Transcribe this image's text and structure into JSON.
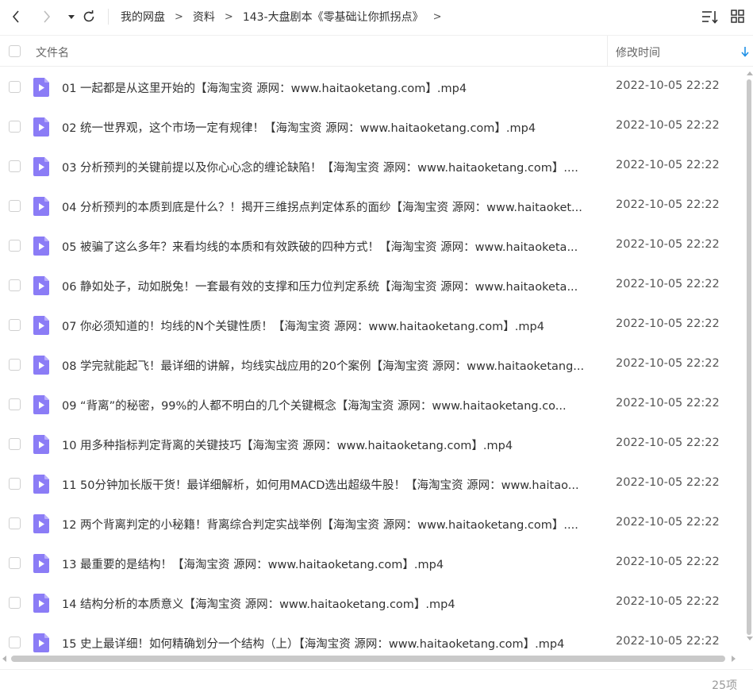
{
  "nav": {
    "back_icon": "chevron-left-icon",
    "forward_icon": "chevron-right-icon",
    "dropdown_icon": "caret-down-icon",
    "refresh_icon": "refresh-icon"
  },
  "breadcrumb": {
    "items": [
      "我的网盘",
      "资料",
      "143-大盘剧本《零基础让你抓拐点》"
    ],
    "separator": ">"
  },
  "toolbar": {
    "sort_icon": "sort-list-icon",
    "view_icon": "grid-view-icon"
  },
  "columns": {
    "name": "文件名",
    "time": "修改时间",
    "sort_icon": "sort-down-arrow-icon"
  },
  "colors": {
    "accent": "#1e90e6",
    "file_icon": "#8b7cf6"
  },
  "files": [
    {
      "name": "01 一起都是从这里开始的【海淘宝资 源网：www.haitaoketang.com】.mp4",
      "time": "2022-10-05 22:22"
    },
    {
      "name": "02 统一世界观，这个市场一定有规律！【海淘宝资 源网：www.haitaoketang.com】.mp4",
      "time": "2022-10-05 22:22"
    },
    {
      "name": "03 分析预判的关键前提以及你心心念的缠论缺陷！【海淘宝资 源网：www.haitaoketang.com】....",
      "time": "2022-10-05 22:22"
    },
    {
      "name": "04 分析预判的本质到底是什么？！揭开三维拐点判定体系的面纱【海淘宝资 源网：www.haitaoket...",
      "time": "2022-10-05 22:22"
    },
    {
      "name": "05 被骗了这么多年？来看均线的本质和有效跌破的四种方式！【海淘宝资 源网：www.haitaoketa...",
      "time": "2022-10-05 22:22"
    },
    {
      "name": "06 静如处子，动如脱兔！一套最有效的支撑和压力位判定系统【海淘宝资 源网：www.haitaoketa...",
      "time": "2022-10-05 22:22"
    },
    {
      "name": "07 你必须知道的！均线的N个关键性质！【海淘宝资 源网：www.haitaoketang.com】.mp4",
      "time": "2022-10-05 22:22"
    },
    {
      "name": "08 学完就能起飞！最详细的讲解，均线实战应用的20个案例【海淘宝资 源网：www.haitaoketang...",
      "time": "2022-10-05 22:22"
    },
    {
      "name": "09 “背离”的秘密，99%的人都不明白的几个关键概念【海淘宝资 源网：www.haitaoketang.co...",
      "time": "2022-10-05 22:22"
    },
    {
      "name": "10 用多种指标判定背离的关键技巧【海淘宝资 源网：www.haitaoketang.com】.mp4",
      "time": "2022-10-05 22:22"
    },
    {
      "name": "11 50分钟加长版干货！最详细解析，如何用MACD选出超级牛股！【海淘宝资 源网：www.haitao...",
      "time": "2022-10-05 22:22"
    },
    {
      "name": "12 两个背离判定的小秘籍！背离综合判定实战举例【海淘宝资 源网：www.haitaoketang.com】....",
      "time": "2022-10-05 22:22"
    },
    {
      "name": "13 最重要的是结构！【海淘宝资 源网：www.haitaoketang.com】.mp4",
      "time": "2022-10-05 22:22"
    },
    {
      "name": "14 结构分析的本质意义【海淘宝资 源网：www.haitaoketang.com】.mp4",
      "time": "2022-10-05 22:22"
    },
    {
      "name": "15 史上最详细！如何精确划分一个结构（上）【海淘宝资 源网：www.haitaoketang.com】.mp4",
      "time": "2022-10-05 22:22"
    }
  ],
  "footer": {
    "count": "25项"
  }
}
